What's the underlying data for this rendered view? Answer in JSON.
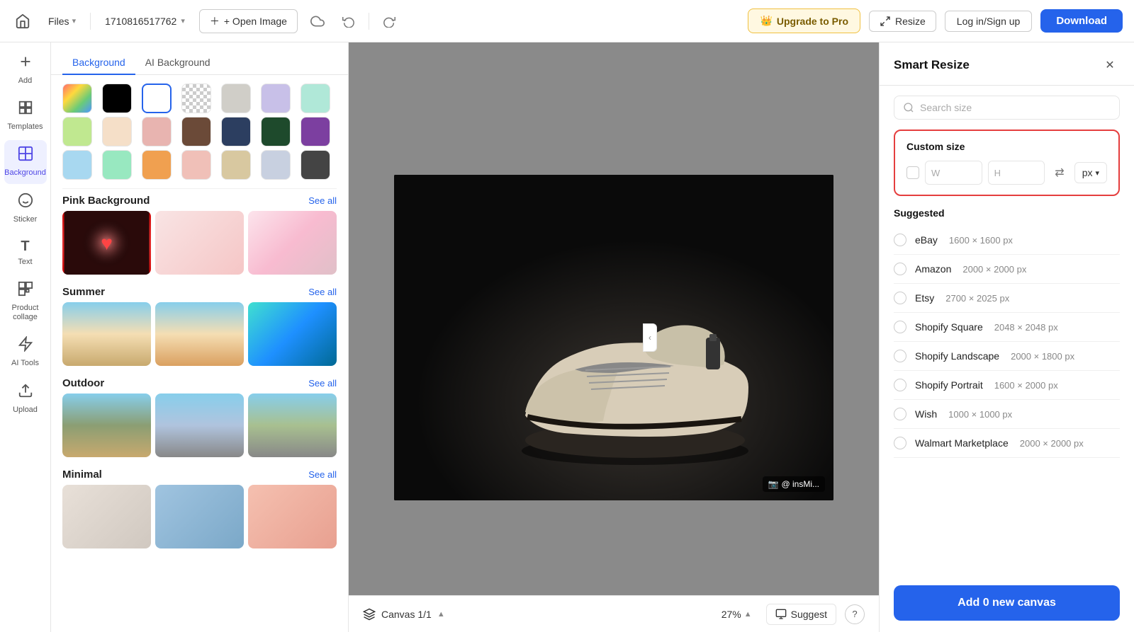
{
  "topbar": {
    "home_icon": "🏠",
    "files_label": "Files",
    "filename": "1710816517762",
    "open_image_label": "+ Open Image",
    "undo_icon": "↩",
    "redo_icon": "↪",
    "upgrade_label": "Upgrade to Pro",
    "resize_label": "Resize",
    "login_label": "Log in/Sign up",
    "download_label": "Download"
  },
  "left_sidebar": {
    "items": [
      {
        "icon": "＋",
        "label": "Add",
        "id": "add"
      },
      {
        "icon": "▦",
        "label": "Templates",
        "id": "templates"
      },
      {
        "icon": "▣",
        "label": "Background",
        "id": "background",
        "active": true
      },
      {
        "icon": "✦",
        "label": "Sticker",
        "id": "sticker"
      },
      {
        "icon": "T",
        "label": "Text",
        "id": "text"
      },
      {
        "icon": "⊞",
        "label": "Product collage",
        "id": "product-collage"
      },
      {
        "icon": "✨",
        "label": "AI Tools",
        "id": "ai-tools"
      },
      {
        "icon": "⬆",
        "label": "Upload",
        "id": "upload"
      }
    ]
  },
  "left_panel": {
    "tabs": [
      {
        "label": "Background",
        "active": true
      },
      {
        "label": "AI Background",
        "active": false
      }
    ],
    "color_swatches": [
      {
        "color": "linear-gradient(135deg,#ff6b6b,#ffd93d,#6bcb77,#4d96ff)",
        "type": "gradient",
        "id": "rainbow"
      },
      {
        "color": "#000000",
        "id": "black"
      },
      {
        "color": "#ffffff",
        "id": "white",
        "selected": true,
        "border": true
      },
      {
        "color": "checkered",
        "id": "transparent"
      },
      {
        "color": "#d0cec8",
        "id": "light-gray"
      },
      {
        "color": "#c8c0e8",
        "id": "light-purple"
      },
      {
        "color": "#b0e8d8",
        "id": "mint"
      },
      {
        "color": "#c0e890",
        "id": "light-green"
      },
      {
        "color": "#f5dfc8",
        "id": "peach"
      },
      {
        "color": "#e8b4b0",
        "id": "light-pink"
      },
      {
        "color": "#6b4a38",
        "id": "brown"
      },
      {
        "color": "#2c3e60",
        "id": "navy"
      },
      {
        "color": "#1e4a2c",
        "id": "dark-green"
      },
      {
        "color": "#7c3fa0",
        "id": "purple"
      },
      {
        "color": "#a8d8f0",
        "id": "sky"
      },
      {
        "color": "#98e8c0",
        "id": "seafoam"
      },
      {
        "color": "#f0a050",
        "id": "orange"
      },
      {
        "color": "#f0c0b8",
        "id": "salmon"
      },
      {
        "color": "#d8c8a0",
        "id": "tan"
      },
      {
        "color": "#c8d0e0",
        "id": "steel"
      },
      {
        "color": "#444444",
        "id": "dark-gray"
      }
    ],
    "sections": [
      {
        "id": "pink-background",
        "title": "Pink Background",
        "see_all": "See all",
        "images": [
          "pink-bg-1",
          "pink-bg-2",
          "pink-bg-3"
        ]
      },
      {
        "id": "summer",
        "title": "Summer",
        "see_all": "See all",
        "images": [
          "summer-1",
          "summer-2",
          "summer-3"
        ]
      },
      {
        "id": "outdoor",
        "title": "Outdoor",
        "see_all": "See all",
        "images": [
          "outdoor-1",
          "outdoor-2",
          "outdoor-3"
        ]
      },
      {
        "id": "minimal",
        "title": "Minimal",
        "see_all": "See all",
        "images": [
          "minimal-1",
          "minimal-2",
          "minimal-3"
        ]
      }
    ]
  },
  "canvas": {
    "info": "Canvas 1/1",
    "zoom": "27%",
    "suggest_label": "Suggest",
    "help_icon": "?",
    "watermark": "@ insMi..."
  },
  "smart_resize": {
    "title": "Smart Resize",
    "close_icon": "✕",
    "search_placeholder": "Search size",
    "custom_size": {
      "label": "Custom size",
      "w_label": "W",
      "h_label": "H",
      "link_icon": "⇄",
      "unit": "px",
      "unit_caret": "▾"
    },
    "suggested_label": "Suggested",
    "items": [
      {
        "id": "ebay",
        "name": "eBay",
        "dims": "1600 × 1600 px"
      },
      {
        "id": "amazon",
        "name": "Amazon",
        "dims": "2000 × 2000 px"
      },
      {
        "id": "etsy",
        "name": "Etsy",
        "dims": "2700 × 2025 px"
      },
      {
        "id": "shopify-square",
        "name": "Shopify Square",
        "dims": "2048 × 2048 px"
      },
      {
        "id": "shopify-landscape",
        "name": "Shopify Landscape",
        "dims": "2000 × 1800 px"
      },
      {
        "id": "shopify-portrait",
        "name": "Shopify Portrait",
        "dims": "1600 × 2000 px"
      },
      {
        "id": "wish",
        "name": "Wish",
        "dims": "1000 × 1000 px"
      },
      {
        "id": "walmart",
        "name": "Walmart Marketplace",
        "dims": "2000 × 2000 px"
      }
    ],
    "add_canvas_label": "Add 0 new canvas"
  }
}
